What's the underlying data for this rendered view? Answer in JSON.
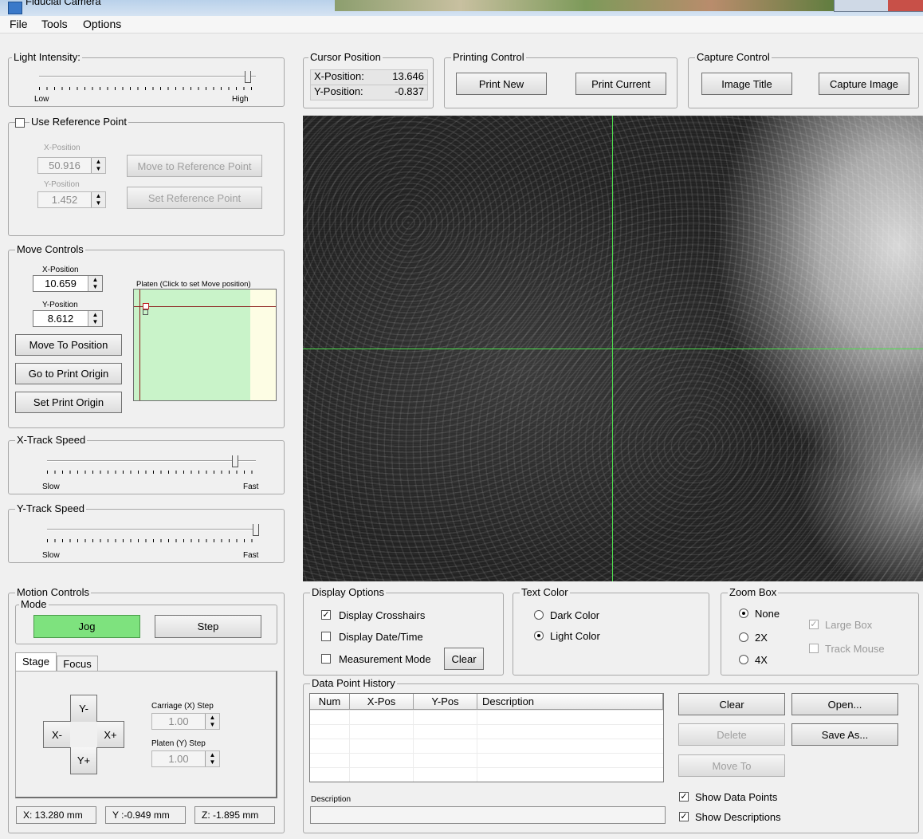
{
  "window": {
    "title": "Fiducial Camera"
  },
  "menu": {
    "file": "File",
    "tools": "Tools",
    "options": "Options"
  },
  "light_intensity": {
    "legend": "Light Intensity:",
    "low": "Low",
    "high": "High",
    "level": 1.0
  },
  "reference": {
    "checkbox_label": "Use Reference Point",
    "x_label": "X-Position",
    "x_value": "50.916",
    "y_label": "Y-Position",
    "y_value": "1.452",
    "move_button": "Move to Reference Point",
    "set_button": "Set Reference Point"
  },
  "move_controls": {
    "legend": "Move Controls",
    "x_label": "X-Position",
    "x_value": "10.659",
    "y_label": "Y-Position",
    "y_value": "8.612",
    "platen_label": "Platen (Click to set Move position)",
    "move_button": "Move To Position",
    "origin_button": "Go to Print Origin",
    "set_origin_button": "Set Print Origin"
  },
  "x_track": {
    "legend": "X-Track Speed",
    "slow": "Slow",
    "fast": "Fast",
    "level": 0.88
  },
  "y_track": {
    "legend": "Y-Track Speed",
    "slow": "Slow",
    "fast": "Fast",
    "level": 1.0
  },
  "motion": {
    "legend": "Motion Controls",
    "mode_legend": "Mode",
    "jog": "Jog",
    "step": "Step",
    "tab_stage": "Stage",
    "tab_focus": "Focus",
    "y_minus": "Y-",
    "y_plus": "Y+",
    "x_minus": "X-",
    "x_plus": "X+",
    "carriage_label": "Carriage (X) Step",
    "carriage_value": "1.00",
    "platen_label": "Platen (Y) Step",
    "platen_value": "1.00"
  },
  "status": {
    "x": "X: 13.280 mm",
    "y": "Y :-0.949 mm",
    "z": "Z: -1.895 mm"
  },
  "cursor": {
    "legend": "Cursor Position",
    "x_label": "X-Position:",
    "x_value": "13.646",
    "y_label": "Y-Position:",
    "y_value": "-0.837"
  },
  "printing": {
    "legend": "Printing Control",
    "print_new": "Print New",
    "print_current": "Print Current"
  },
  "capture": {
    "legend": "Capture Control",
    "image_title": "Image Title",
    "capture_image": "Capture Image"
  },
  "display": {
    "legend": "Display Options",
    "crosshairs": "Display Crosshairs",
    "datetime": "Display Date/Time",
    "measurement": "Measurement Mode",
    "clear": "Clear"
  },
  "text_color": {
    "legend": "Text Color",
    "dark": "Dark Color",
    "light": "Light Color"
  },
  "zoom": {
    "legend": "Zoom Box",
    "none": "None",
    "x2": "2X",
    "x4": "4X",
    "large_box": "Large Box",
    "track_mouse": "Track Mouse"
  },
  "history": {
    "legend": "Data Point History",
    "columns": [
      "Num",
      "X-Pos",
      "Y-Pos",
      "Description"
    ],
    "description_label": "Description",
    "clear": "Clear",
    "open": "Open...",
    "delete": "Delete",
    "save_as": "Save As...",
    "move_to": "Move To",
    "show_points": "Show Data Points",
    "show_descriptions": "Show Descriptions"
  },
  "colors": {
    "crosshair": "#4fe04f",
    "jog_active": "#7ee27e",
    "platen_area": "#c9f3c9",
    "platen_marker": "#8b1a1a"
  }
}
